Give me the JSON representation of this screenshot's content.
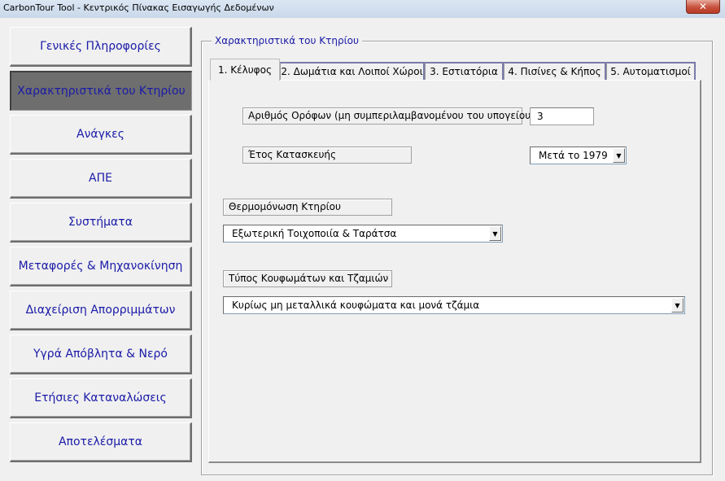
{
  "window": {
    "title": "CarbonTour Tool - Κεντρικός Πίνακας Εισαγωγής Δεδομένων",
    "close_glyph": "✕"
  },
  "nav": [
    {
      "label": "Γενικές Πληροφορίες"
    },
    {
      "label": "Χαρακτηριστικά του Κτηρίου"
    },
    {
      "label": "Ανάγκες"
    },
    {
      "label": "ΑΠΕ"
    },
    {
      "label": "Συστήματα"
    },
    {
      "label": "Μεταφορές & Μηχανοκίνηση"
    },
    {
      "label": "Διαχείριση Απορριμμάτων"
    },
    {
      "label": "Υγρά Απόβλητα & Νερό"
    },
    {
      "label": "Ετήσιες Καταναλώσεις"
    },
    {
      "label": "Αποτελέσματα"
    }
  ],
  "frame": {
    "caption": "Χαρακτηριστικά του Κτηρίου"
  },
  "tabs": [
    {
      "label": "1.  Κέλυφος"
    },
    {
      "label": "2.  Δωμάτια και Λοιποί Χώροι"
    },
    {
      "label": "3.  Εστιατόρια"
    },
    {
      "label": "4.  Πισίνες & Κήπος"
    },
    {
      "label": "5.  Αυτοματισμοί"
    }
  ],
  "form": {
    "floors_label": "Αριθμός Ορόφων (μη συμπεριλαμβανομένου του υπογείου)",
    "floors_value": "3",
    "year_label": "Έτος Κατασκευής",
    "year_value": "Μετά το 1979",
    "insulation_label": "Θερμομόνωση Κτηρίου",
    "insulation_value": "Εξωτερική Τοιχοποιία & Ταράτσα",
    "windows_label": "Τύπος Κουφωμάτων και Τζαμιών",
    "windows_value": "Κυρίως μη μεταλλικά κουφώματα και μονά τζάμια",
    "dropdown_glyph": "▼"
  }
}
